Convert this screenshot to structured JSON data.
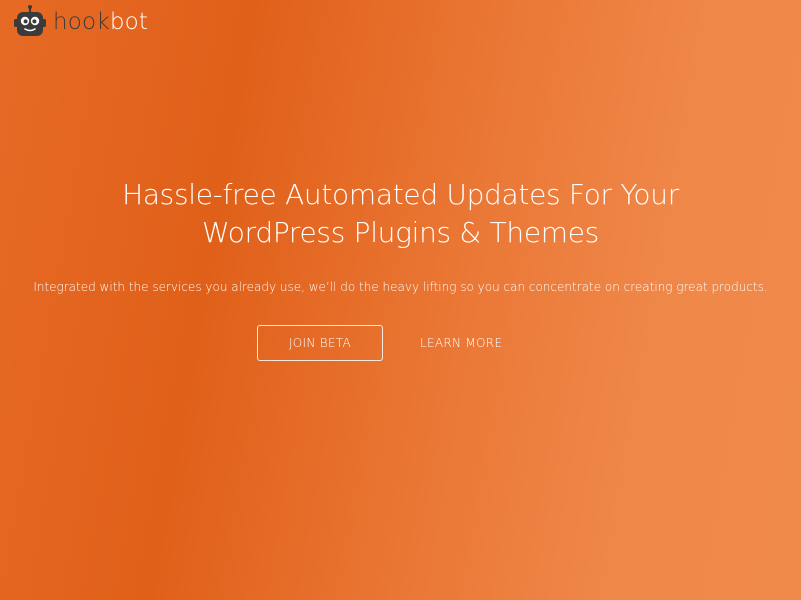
{
  "brand": {
    "name_prefix": "hook",
    "name_suffix": "bot",
    "logo_icon": "robot-icon",
    "text_color": "#3b3b3b",
    "accent_color": "#ffffff"
  },
  "hero": {
    "headline": "Hassle-free Automated Updates For Your WordPress Plugins & Themes",
    "subline": "Integrated with the services you already use, we’ll do the heavy lifting so you can concentrate on creating great products.",
    "background_colors": [
      "#e06019",
      "#f08a4b"
    ]
  },
  "actions": {
    "primary_label": "JOIN BETA",
    "secondary_label": "LEARN MORE"
  }
}
